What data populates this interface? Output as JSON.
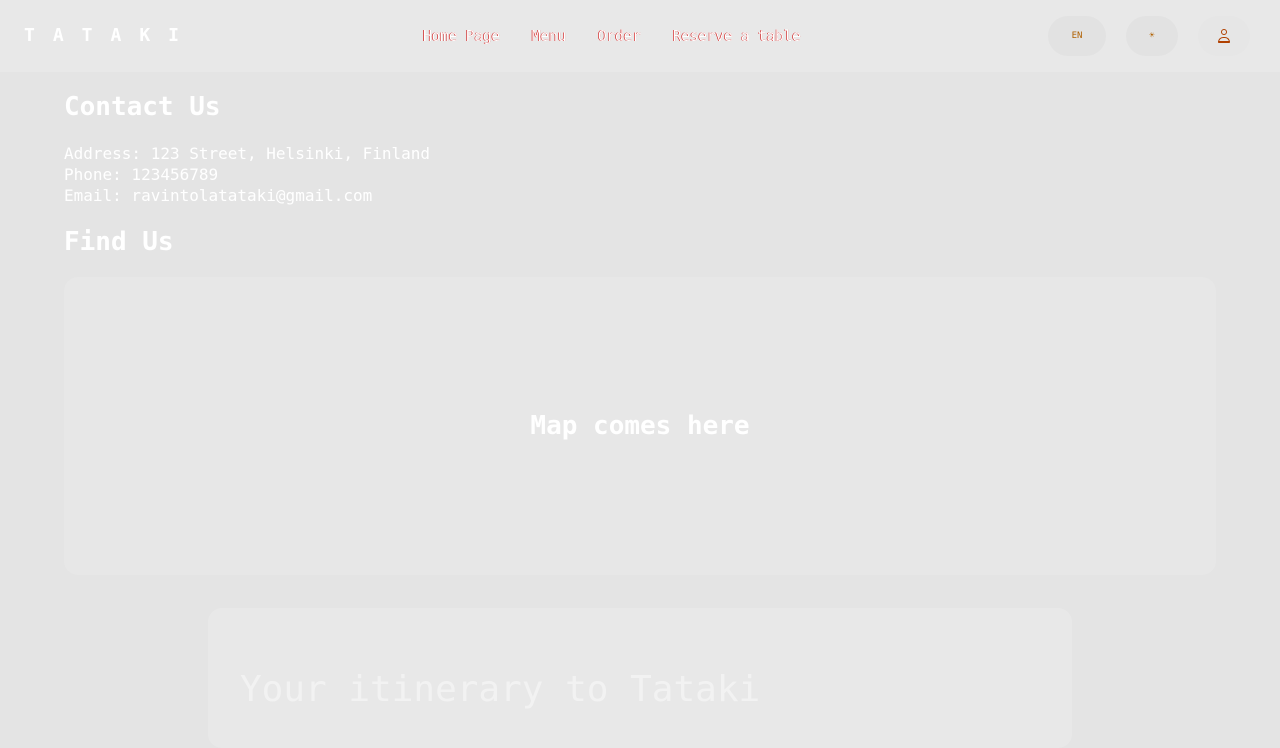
{
  "header": {
    "logo": "TATAKI",
    "nav": [
      "Home Page",
      "Menu",
      "Order",
      "Reserve a table"
    ],
    "lang_label": "EN",
    "theme_label": "☀"
  },
  "contact": {
    "title": "Contact Us",
    "address": "Address: 123 Street, Helsinki, Finland",
    "phone": "Phone: 123456789",
    "email": "Email: ravintolatataki@gmail.com"
  },
  "find": {
    "title": "Find Us",
    "map_placeholder": "Map comes here"
  },
  "itinerary": {
    "title": "Your itinerary to Tataki"
  }
}
